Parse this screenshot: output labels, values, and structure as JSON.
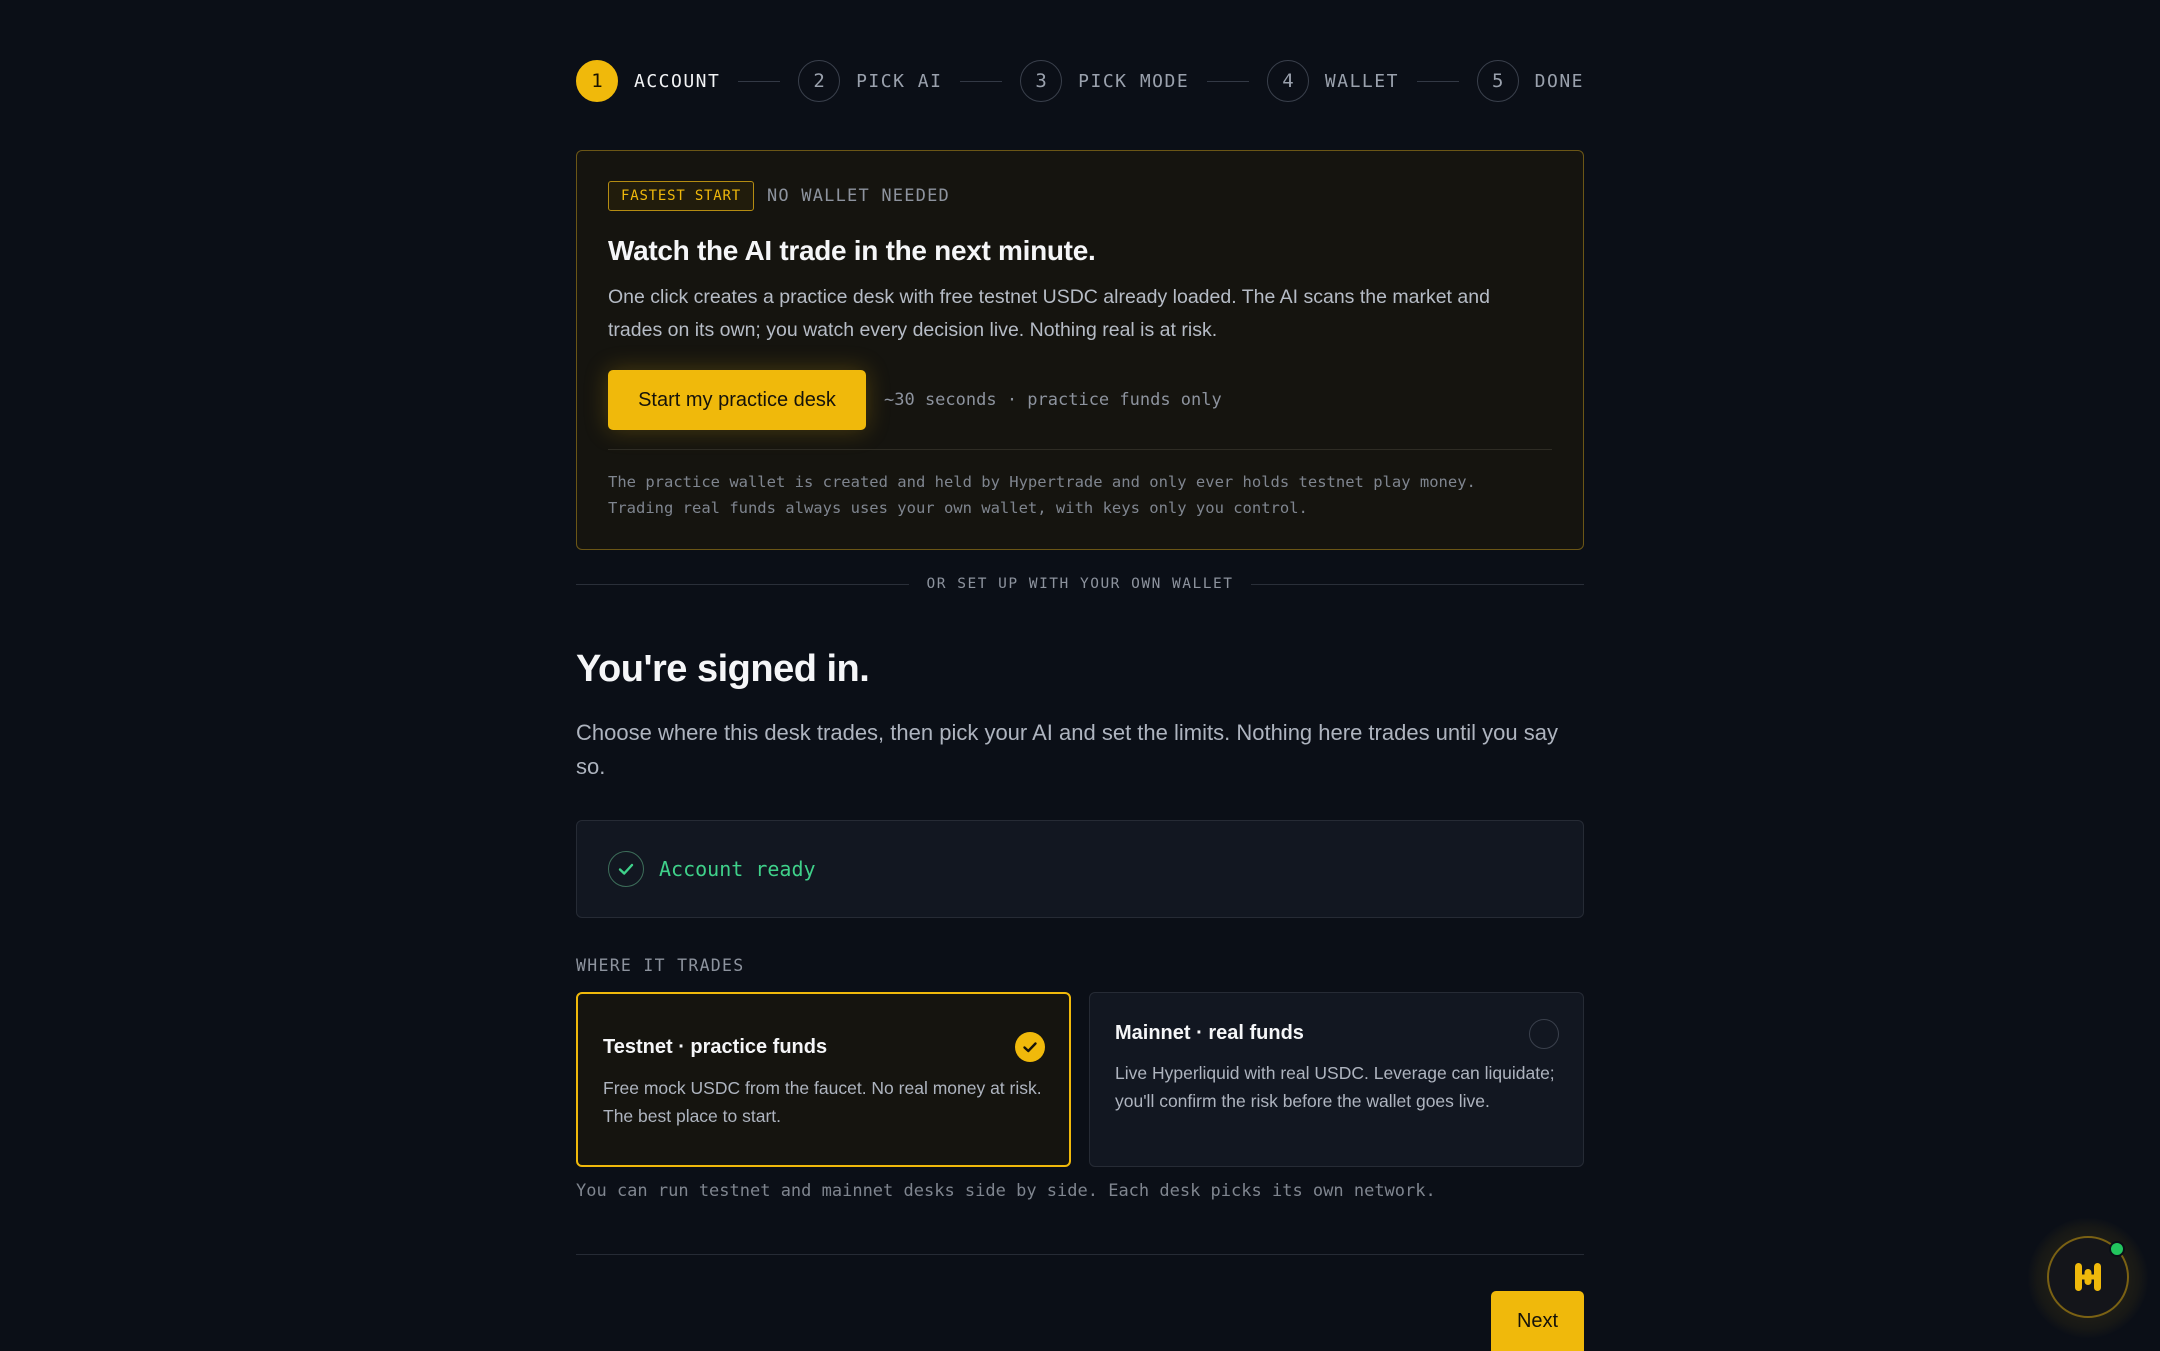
{
  "stepper": {
    "steps": [
      {
        "num": "1",
        "label": "ACCOUNT"
      },
      {
        "num": "2",
        "label": "PICK AI"
      },
      {
        "num": "3",
        "label": "PICK MODE"
      },
      {
        "num": "4",
        "label": "WALLET"
      },
      {
        "num": "5",
        "label": "DONE"
      }
    ],
    "active_index": 0
  },
  "fast_start": {
    "badge": "FASTEST START",
    "badge_side": "NO WALLET NEEDED",
    "title": "Watch the AI trade in the next minute.",
    "description": "One click creates a practice desk with free testnet USDC already loaded. The AI scans the market and trades on its own; you watch every decision live. Nothing real is at risk.",
    "cta_label": "Start my practice desk",
    "cta_note": "~30 seconds · practice funds only",
    "fine_print_1": "The practice wallet is created and held by Hypertrade and only ever holds testnet play money.",
    "fine_print_2": "Trading real funds always uses your own wallet, with keys only you control."
  },
  "divider_text": "OR SET UP WITH YOUR OWN WALLET",
  "signed_in": {
    "title": "You're signed in.",
    "description": "Choose where this desk trades, then pick your AI and set the limits. Nothing here trades until you say so."
  },
  "account_status": "Account ready",
  "where": {
    "label": "WHERE IT TRADES",
    "options": [
      {
        "title": "Testnet · practice funds",
        "description": "Free mock USDC from the faucet. No real money at risk. The best place to start.",
        "selected": true
      },
      {
        "title": "Mainnet · real funds",
        "description": "Live Hyperliquid with real USDC. Leverage can liquidate; you'll confirm the risk before the wallet goes live.",
        "selected": false
      }
    ],
    "note": "You can run testnet and mainnet desks side by side. Each desk picks its own network."
  },
  "next_label": "Next",
  "colors": {
    "accent": "#f0b90b",
    "background": "#0b0f17",
    "success": "#3fd18a",
    "online_dot": "#22c55e"
  },
  "icons": {
    "check": "check-icon",
    "radio": "radio-empty-icon",
    "assistant": "hypertrade-logo-icon"
  }
}
